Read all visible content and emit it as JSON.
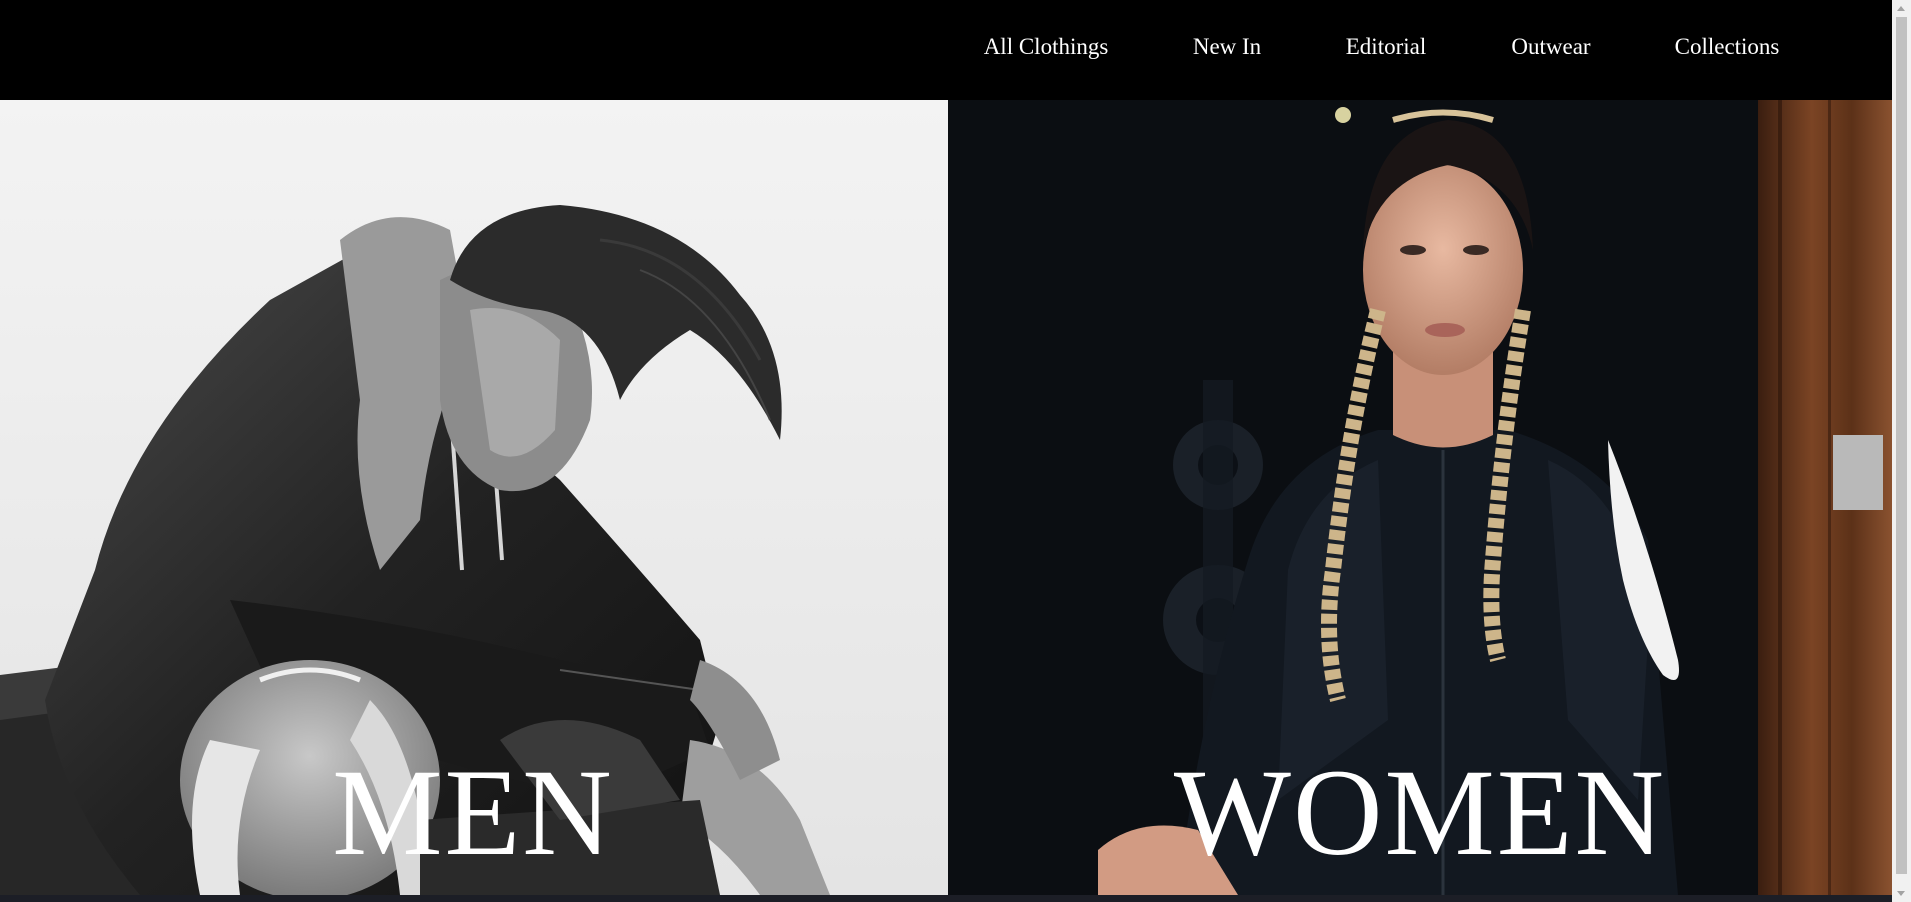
{
  "nav": {
    "items": [
      {
        "label": "All Clothings"
      },
      {
        "label": "New In"
      },
      {
        "label": "Editorial"
      },
      {
        "label": "Outwear"
      },
      {
        "label": "Collections"
      }
    ]
  },
  "hero": {
    "men": {
      "label": "MEN",
      "image": "man-in-leather-jacket-photo"
    },
    "women": {
      "label": "WOMEN",
      "image": "woman-with-braids-photo"
    }
  },
  "colors": {
    "nav_background": "#000000",
    "nav_text": "#ffffff",
    "label_text": "#ffffff"
  }
}
